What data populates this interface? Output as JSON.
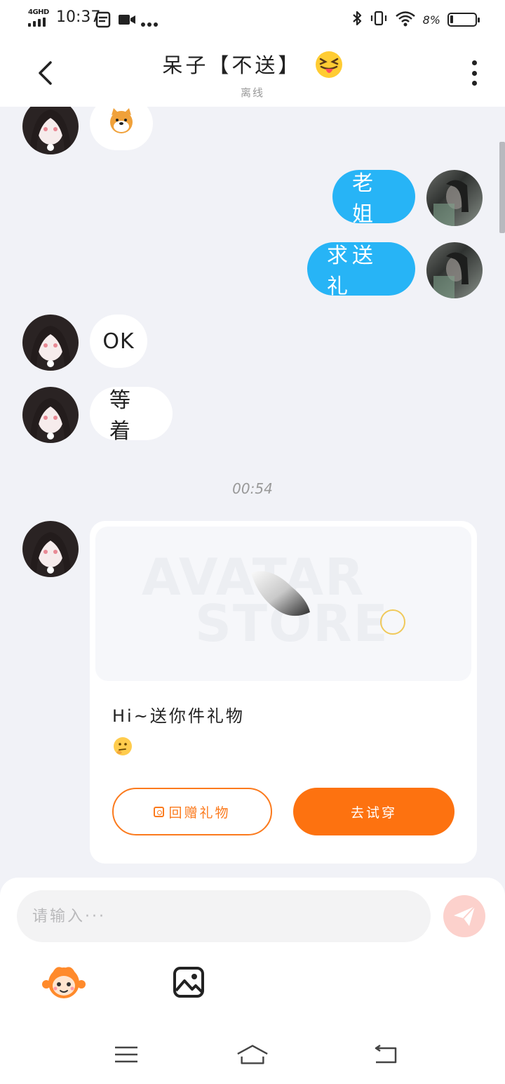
{
  "status_bar": {
    "network": "4GHD",
    "time": "10:37",
    "battery": "8%"
  },
  "header": {
    "title": "呆子【不送】",
    "subtitle": "离线"
  },
  "messages": {
    "m0_text": "",
    "m1_text": "老姐",
    "m2_text": "求送礼",
    "m3_text": "OK",
    "m4_text": "等着",
    "timestamp": "00:54"
  },
  "gift_card": {
    "watermark_line1": "AVATAR",
    "watermark_line2": "STORE",
    "text": "Hi~送你件礼物",
    "button_outline": "回赠礼物",
    "button_solid": "去试穿"
  },
  "input": {
    "placeholder": "请输入···"
  },
  "icons": {
    "back": "chevron-left-icon",
    "more": "more-vertical-icon",
    "send": "send-icon",
    "mascot": "mascot-icon",
    "image": "image-icon",
    "nav_menu": "menu-icon",
    "nav_home": "home-icon",
    "nav_back": "back-arrow-icon"
  },
  "colors": {
    "outgoing_bubble": "#27b4f6",
    "accent_orange": "#fd7210",
    "send_button": "#fcd1cc",
    "background": "#f1f2f7"
  }
}
